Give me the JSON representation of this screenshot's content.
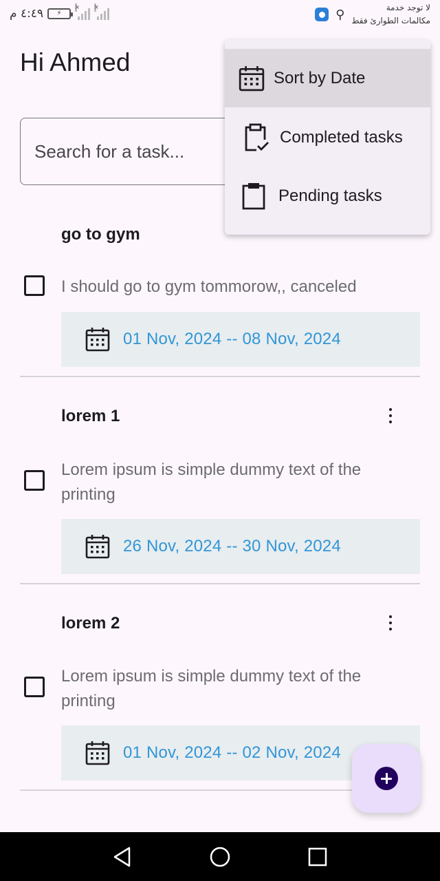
{
  "status_bar": {
    "time": "٤:٤٩ م",
    "carrier_line1": "لا توجد خدمة",
    "carrier_line2": "مكالمات الطوارئ فقط"
  },
  "header": {
    "greeting": "Hi Ahmed"
  },
  "search": {
    "placeholder": "Search for a task..."
  },
  "menu": {
    "items": [
      {
        "label": "Sort by Date",
        "icon": "calendar-icon",
        "active": true
      },
      {
        "label": "Completed tasks",
        "icon": "clipboard-check-icon",
        "active": false
      },
      {
        "label": "Pending tasks",
        "icon": "clipboard-icon",
        "active": false
      }
    ]
  },
  "tasks": [
    {
      "title": "go to gym",
      "description": "I should go to gym tommorow,, canceled",
      "date_range": "01 Nov, 2024 -- 08 Nov, 2024",
      "checked": false
    },
    {
      "title": "lorem 1",
      "description": "Lorem ipsum is simple dummy text of the printing",
      "date_range": "26 Nov, 2024 -- 30 Nov, 2024",
      "checked": false
    },
    {
      "title": "lorem 2",
      "description": "Lorem ipsum is simple dummy text of the printing",
      "date_range": "01 Nov, 2024 -- 02 Nov, 2024",
      "checked": false
    }
  ],
  "colors": {
    "background": "#fdf7fd",
    "date_text": "#3296d6",
    "date_box": "#e8edf0",
    "fab_background": "#eadcfb",
    "fab_icon": "#21005d",
    "menu_background": "#f3edf6"
  }
}
